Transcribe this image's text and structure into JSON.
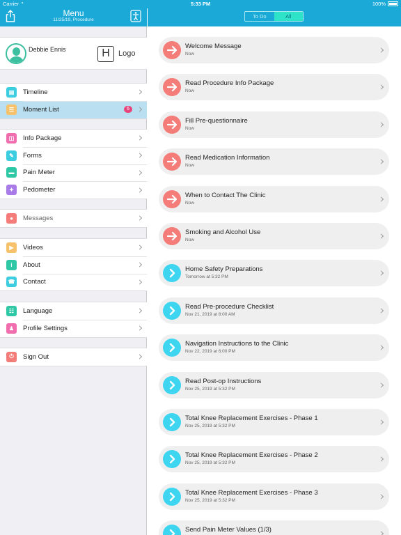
{
  "status_bar": {
    "carrier": "Carrier",
    "time": "5:33 PM",
    "battery": "100%"
  },
  "menu": {
    "title": "Menu",
    "subtitle": "11/25/19, Procedure",
    "user_name": "Debbie Ennis",
    "logo_letter": "H",
    "logo_text": "Logo",
    "groups": [
      [
        {
          "label": "Timeline",
          "icon": "timeline-icon",
          "color": "#3ccde0"
        },
        {
          "label": "Moment List",
          "icon": "moment-list-icon",
          "color": "#f5c26b",
          "badge": "6",
          "active": true
        }
      ],
      [
        {
          "label": "Info Package",
          "icon": "info-package-icon",
          "color": "#f06dae"
        },
        {
          "label": "Forms",
          "icon": "forms-icon",
          "color": "#3ccde0"
        },
        {
          "label": "Pain Meter",
          "icon": "pain-meter-icon",
          "color": "#2ec8a6"
        },
        {
          "label": "Pedometer",
          "icon": "pedometer-icon",
          "color": "#a97be8"
        }
      ],
      [
        {
          "label": "Messages",
          "icon": "messages-icon",
          "color": "#f47c79",
          "muted": true
        }
      ],
      [
        {
          "label": "Videos",
          "icon": "videos-icon",
          "color": "#f5c26b"
        },
        {
          "label": "About",
          "icon": "about-icon",
          "color": "#2ec8a6"
        },
        {
          "label": "Contact",
          "icon": "contact-icon",
          "color": "#3ccde0"
        }
      ],
      [
        {
          "label": "Language",
          "icon": "language-icon",
          "color": "#2ec8a6"
        },
        {
          "label": "Profile Settings",
          "icon": "profile-settings-icon",
          "color": "#f06dae"
        }
      ],
      [
        {
          "label": "Sign Out",
          "icon": "sign-out-icon",
          "color": "#f47c79"
        }
      ]
    ]
  },
  "tabs": {
    "todo": "To Do",
    "all": "All",
    "selected": "All"
  },
  "moments": [
    {
      "title": "Welcome Message",
      "time": "Now",
      "state": "due"
    },
    {
      "title": "Read Procedure Info Package",
      "time": "Now",
      "state": "due"
    },
    {
      "title": "Fill Pre-questionnaire",
      "time": "Now",
      "state": "due"
    },
    {
      "title": "Read Medication Information",
      "time": "Now",
      "state": "due"
    },
    {
      "title": "When to Contact The Clinic",
      "time": "Now",
      "state": "due"
    },
    {
      "title": "Smoking and Alcohol Use",
      "time": "Now",
      "state": "due"
    },
    {
      "title": "Home Safety Preparations",
      "time": "Tomorrow at 5:32 PM",
      "state": "upcoming"
    },
    {
      "title": "Read Pre-procedure Checklist",
      "time": "Nov 21, 2019 at 8:00 AM",
      "state": "upcoming"
    },
    {
      "title": "Navigation Instructions to the Clinic",
      "time": "Nov 22, 2019 at 6:00 PM",
      "state": "upcoming"
    },
    {
      "title": "Read Post-op Instructions",
      "time": "Nov 25, 2019 at 5:32 PM",
      "state": "upcoming"
    },
    {
      "title": "Total Knee Replacement Exercises - Phase 1",
      "time": "Nov 25, 2019 at 5:32 PM",
      "state": "upcoming"
    },
    {
      "title": "Total Knee Replacement Exercises - Phase 2",
      "time": "Nov 25, 2019 at 5:32 PM",
      "state": "upcoming"
    },
    {
      "title": "Total Knee Replacement Exercises - Phase 3",
      "time": "Nov 25, 2019 at 5:32 PM",
      "state": "upcoming"
    },
    {
      "title": "Send Pain Meter Values (1/3)",
      "time": "",
      "state": "upcoming"
    }
  ]
}
